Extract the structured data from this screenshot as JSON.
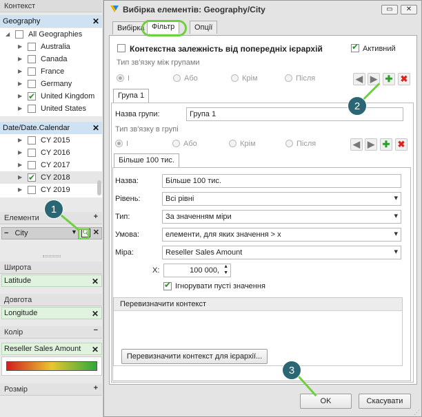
{
  "left": {
    "context_title": "Контекст",
    "geo_header": "Geography",
    "geo_items": [
      {
        "label": "All Geographies",
        "checked": false,
        "level": 0
      },
      {
        "label": "Australia",
        "checked": false
      },
      {
        "label": "Canada",
        "checked": false
      },
      {
        "label": "France",
        "checked": false
      },
      {
        "label": "Germany",
        "checked": false
      },
      {
        "label": "United Kingdom",
        "checked": true
      },
      {
        "label": "United States",
        "checked": false
      }
    ],
    "date_header": "Date/Date.Calendar",
    "date_items": [
      {
        "label": "CY 2015",
        "checked": false
      },
      {
        "label": "CY 2016",
        "checked": false
      },
      {
        "label": "CY 2017",
        "checked": false
      },
      {
        "label": "CY 2018",
        "checked": true
      },
      {
        "label": "CY 2019",
        "checked": false
      }
    ],
    "elements_title": "Елементи",
    "elements_field": "City",
    "lat_title": "Широта",
    "lat_field": "Latitude",
    "lon_title": "Довгота",
    "lon_field": "Longitude",
    "color_title": "Колір",
    "color_field": "Reseller Sales Amount",
    "size_title": "Розмір",
    "colors": {
      "gradient_start": "#d21f1f",
      "gradient_mid": "#e8c630",
      "gradient_end": "#2ea83a"
    }
  },
  "dialog": {
    "title": "Вибірка елементів: Geography/City",
    "tabs": [
      "Вибірка",
      "Фільтр",
      "Опції"
    ],
    "context_dep": "Контекстна залежність від попередніх ієрархій",
    "active_label": "Активний",
    "link_type_groups": "Тип зв'язку між групами",
    "radios": [
      "І",
      "Або",
      "Крім",
      "Після"
    ],
    "group_tab": "Група 1",
    "group_name_label": "Назва групи:",
    "group_name_value": "Група 1",
    "link_type_in_group": "Тип зв'язку в групі",
    "cond_tab": "Більше 100 тис.",
    "name_label": "Назва:",
    "name_value": "Більше 100 тис.",
    "level_label": "Рівень:",
    "level_value": "Всі рівні",
    "type_label": "Тип:",
    "type_value": "За значенням міри",
    "condition_label": "Умова:",
    "condition_value": "елементи, для яких значення > x",
    "measure_label": "Міра:",
    "measure_value": "Reseller Sales Amount",
    "x_label": "X:",
    "x_value": "100 000,",
    "ignore_empty": "Ігнорувати пусті значення",
    "override_title": "Перевизначити контекст",
    "override_button": "Перевизначити контекст для ієрархії...",
    "ok": "OK",
    "cancel": "Скасувати"
  },
  "badges": [
    "1",
    "2",
    "3"
  ]
}
